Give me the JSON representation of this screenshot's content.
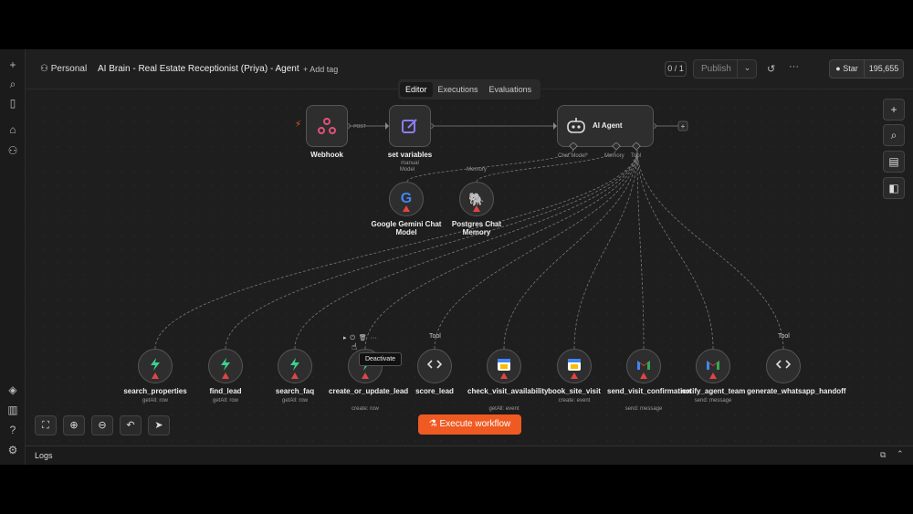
{
  "header": {
    "project": "Personal",
    "workflow_title": "AI Brain - Real Estate Receptionist (Priya) - Agent",
    "add_tag": "+ Add tag",
    "counter": "0 / 1",
    "publish": "Publish",
    "github_star": "Star",
    "github_count": "195,655"
  },
  "tabs": [
    {
      "label": "Editor",
      "active": true
    },
    {
      "label": "Executions",
      "active": false
    },
    {
      "label": "Evaluations",
      "active": false
    }
  ],
  "nodes": {
    "webhook": {
      "label": "Webhook"
    },
    "post_label": "POST",
    "set_variables": {
      "label": "set variables",
      "sub": "manual"
    },
    "ai_agent": {
      "label": "AI Agent",
      "ports": {
        "chat_model": "Chat Model*",
        "memory": "Memory",
        "tool": "Tool"
      }
    },
    "gemini": {
      "label": "Google Gemini Chat Model",
      "port_label": "Model"
    },
    "postgres": {
      "label": "Postgres Chat Memory",
      "port_label": "Memory"
    },
    "tools": [
      {
        "label": "search_properties",
        "sub": "getAll: row",
        "icon": "bolt-icon"
      },
      {
        "label": "find_lead",
        "sub": "getAll: row",
        "icon": "bolt-icon"
      },
      {
        "label": "search_faq",
        "sub": "getAll: row",
        "icon": "bolt-icon"
      },
      {
        "label": "create_or_update_lead",
        "sub": "create: row",
        "icon": "bolt-icon"
      },
      {
        "label": "score_lead",
        "sub": "",
        "icon": "code-icon"
      },
      {
        "label": "check_visit_availability",
        "sub": "getAll: event",
        "icon": "calendar-icon"
      },
      {
        "label": "book_site_visit",
        "sub": "create: event",
        "icon": "calendar-icon"
      },
      {
        "label": "send_visit_confirmation",
        "sub": "send: message",
        "icon": "gmail-icon"
      },
      {
        "label": "notify_agent_team",
        "sub": "send: message",
        "icon": "gmail-icon"
      },
      {
        "label": "generate_whatsapp_handoff",
        "sub": "",
        "icon": "code-icon"
      }
    ],
    "tool_tag": "Tool"
  },
  "tooltip": "Deactivate",
  "execute_button": "Execute workflow",
  "logs": "Logs",
  "colors": {
    "accent": "#ef5a23",
    "warning": "#e04545",
    "bolt": "#3ecf8e"
  }
}
